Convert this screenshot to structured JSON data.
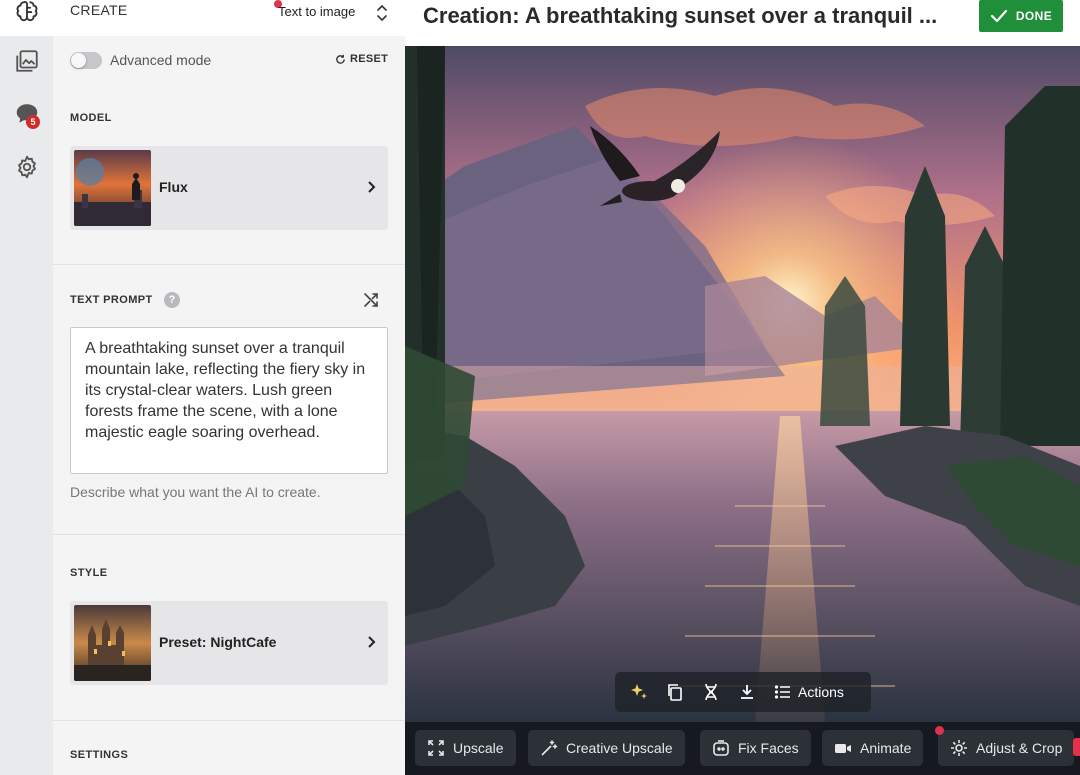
{
  "nav": {
    "items": [
      {
        "icon": "brain-icon",
        "active": true
      },
      {
        "icon": "gallery-icon",
        "active": false
      },
      {
        "icon": "chat-icon",
        "active": false,
        "badge": "5"
      },
      {
        "icon": "gear-icon",
        "active": false
      }
    ]
  },
  "panel": {
    "create_label": "CREATE",
    "mode": "Text to image",
    "advanced_label": "Advanced mode",
    "advanced_on": false,
    "reset_label": "RESET",
    "model_title": "MODEL",
    "model_name": "Flux",
    "prompt_title": "TEXT PROMPT",
    "prompt_text": "A breathtaking sunset over a tranquil mountain lake, reflecting the fiery sky in its crystal-clear waters. Lush green forests frame the scene, with a lone majestic eagle soaring overhead.",
    "prompt_hint": "Describe what you want the AI to create.",
    "style_title": "STYLE",
    "style_name": "Preset: NightCafe",
    "settings_title": "SETTINGS"
  },
  "main": {
    "title": "Creation: A breathtaking sunset over a tranquil ...",
    "done_label": "DONE",
    "floating_actions_label": "Actions",
    "bottom_actions": [
      {
        "label": "Upscale",
        "icon": "expand-icon"
      },
      {
        "label": "Creative Upscale",
        "icon": "magic-wand-icon"
      },
      {
        "label": "Fix Faces",
        "icon": "face-fix-icon"
      },
      {
        "label": "Animate",
        "icon": "video-camera-icon"
      },
      {
        "label": "Adjust & Crop",
        "icon": "adjust-icon"
      }
    ]
  },
  "colors": {
    "done_green": "#1f8f3a",
    "badge_red": "#d22b2b",
    "accent_dot": "#e0324b"
  }
}
